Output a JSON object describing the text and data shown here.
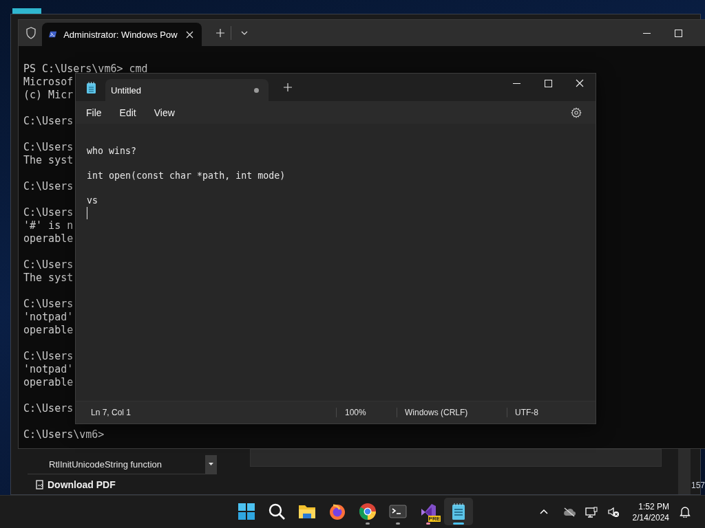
{
  "background_window": {
    "nav_item": "RtlInitUnicodeString function",
    "download_link": "Download PDF",
    "edge_text": "157"
  },
  "terminal": {
    "tab_title": "Administrator: Windows Pow",
    "blocks": [
      [
        "PS C:\\Users\\vm6> cmd",
        "Microsof",
        "(c) Micr"
      ],
      [
        "C:\\Users"
      ],
      [
        "C:\\Users",
        "The syst"
      ],
      [
        "C:\\Users"
      ],
      [
        "C:\\Users",
        "'#' is n",
        "operable"
      ],
      [
        "C:\\Users",
        "The syst"
      ],
      [
        "C:\\Users",
        "'notpad'",
        "operable"
      ],
      [
        "C:\\Users",
        "'notpad'",
        "operable"
      ],
      [
        "C:\\Users"
      ],
      [
        "C:\\Users\\vm6>"
      ]
    ]
  },
  "notepad": {
    "tab_title": "Untitled",
    "unsaved": true,
    "menu": [
      "File",
      "Edit",
      "View"
    ],
    "text": "\nwho wins?\n\nint open(const char *path, int mode)\n\nvs",
    "status": {
      "position": "Ln 7, Col 1",
      "zoom": "100%",
      "line_ending": "Windows (CRLF)",
      "encoding": "UTF-8"
    }
  },
  "taskbar": {
    "apps": [
      {
        "kind": "start",
        "running": false,
        "selected": false
      },
      {
        "kind": "search",
        "running": false,
        "selected": false
      },
      {
        "kind": "explorer",
        "running": false,
        "selected": false
      },
      {
        "kind": "firefox",
        "running": false,
        "selected": false
      },
      {
        "kind": "chrome",
        "running": true,
        "selected": false,
        "color": "#9a9a9a"
      },
      {
        "kind": "terminal",
        "running": true,
        "selected": false,
        "color": "#9a9a9a"
      },
      {
        "kind": "visual-studio",
        "running": true,
        "selected": false,
        "color": "#f28aa8",
        "badge": "PRE"
      },
      {
        "kind": "notepad",
        "running": true,
        "selected": true,
        "color": "#4cc2f1"
      }
    ],
    "clock": {
      "time": "1:52 PM",
      "date": "2/14/2024"
    }
  }
}
